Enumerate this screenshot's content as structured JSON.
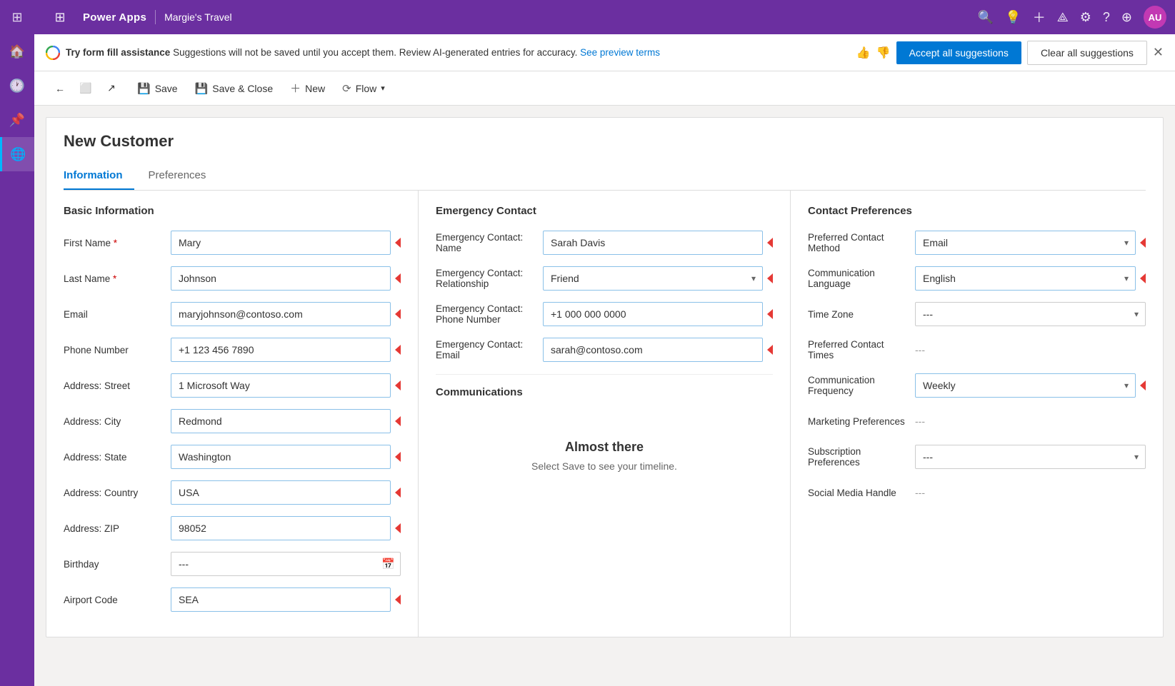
{
  "app": {
    "name": "Power Apps",
    "tenant": "Margie's Travel"
  },
  "topbar": {
    "icons": [
      "⊞",
      "🔍",
      "💡",
      "+",
      "⟁",
      "⚙",
      "?",
      "⊕"
    ],
    "avatar": "AU"
  },
  "suggestion_bar": {
    "bold_text": "Try form fill assistance",
    "text": "Suggestions will not be saved until you accept them. Review AI-generated entries for accuracy.",
    "link_text": "See preview terms",
    "accept_btn": "Accept all suggestions",
    "clear_btn": "Clear all suggestions"
  },
  "toolbar": {
    "back_tooltip": "Back",
    "restore_tooltip": "Restore",
    "forward_tooltip": "Forward",
    "save_label": "Save",
    "save_close_label": "Save & Close",
    "new_label": "New",
    "flow_label": "Flow"
  },
  "form": {
    "title": "New Customer",
    "tabs": [
      "Information",
      "Preferences"
    ],
    "active_tab": "Information"
  },
  "basic_info": {
    "section_title": "Basic Information",
    "fields": [
      {
        "label": "First Name",
        "value": "Mary",
        "type": "input",
        "required": true,
        "has_arrow": true
      },
      {
        "label": "Last Name",
        "value": "Johnson",
        "type": "input",
        "required": true,
        "has_arrow": true
      },
      {
        "label": "Email",
        "value": "maryjohnson@contoso.com",
        "type": "input",
        "required": false,
        "has_arrow": true
      },
      {
        "label": "Phone Number",
        "value": "+1 123 456 7890",
        "type": "input",
        "required": false,
        "has_arrow": true
      },
      {
        "label": "Address: Street",
        "value": "1 Microsoft Way",
        "type": "input",
        "required": false,
        "has_arrow": true
      },
      {
        "label": "Address: City",
        "value": "Redmond",
        "type": "input",
        "required": false,
        "has_arrow": true
      },
      {
        "label": "Address: State",
        "value": "Washington",
        "type": "input",
        "required": false,
        "has_arrow": true
      },
      {
        "label": "Address: Country",
        "value": "USA",
        "type": "input",
        "required": false,
        "has_arrow": true
      },
      {
        "label": "Address: ZIP",
        "value": "98052",
        "type": "input",
        "required": false,
        "has_arrow": true
      },
      {
        "label": "Birthday",
        "value": "---",
        "type": "date",
        "required": false,
        "has_arrow": false
      },
      {
        "label": "Airport Code",
        "value": "SEA",
        "type": "input",
        "required": false,
        "has_arrow": true
      }
    ]
  },
  "emergency_contact": {
    "section_title": "Emergency Contact",
    "fields": [
      {
        "label": "Emergency Contact: Name",
        "value": "Sarah Davis",
        "type": "input",
        "has_arrow": true
      },
      {
        "label": "Emergency Contact: Relationship",
        "value": "Friend",
        "type": "select",
        "has_arrow": true
      },
      {
        "label": "Emergency Contact: Phone Number",
        "value": "+1 000 000 0000",
        "type": "input",
        "has_arrow": true
      },
      {
        "label": "Emergency Contact: Email",
        "value": "sarah@contoso.com",
        "type": "input",
        "has_arrow": true
      }
    ],
    "communications_title": "Communications",
    "almost_there_title": "Almost there",
    "almost_there_text": "Select Save to see your timeline."
  },
  "contact_preferences": {
    "section_title": "Contact Preferences",
    "fields": [
      {
        "label": "Preferred Contact Method",
        "value": "Email",
        "type": "select",
        "has_arrow": true
      },
      {
        "label": "Communication Language",
        "value": "English",
        "type": "select",
        "has_arrow": true
      },
      {
        "label": "Time Zone",
        "value": "---",
        "type": "select",
        "has_arrow": false
      },
      {
        "label": "Preferred Contact Times",
        "value": "---",
        "type": "static",
        "has_arrow": false
      },
      {
        "label": "Communication Frequency",
        "value": "Weekly",
        "type": "select",
        "has_arrow": true
      },
      {
        "label": "Marketing Preferences",
        "value": "---",
        "type": "static",
        "has_arrow": false
      },
      {
        "label": "Subscription Preferences",
        "value": "---",
        "type": "select",
        "has_arrow": false
      },
      {
        "label": "Social Media Handle",
        "value": "---",
        "type": "static",
        "has_arrow": false
      }
    ]
  }
}
